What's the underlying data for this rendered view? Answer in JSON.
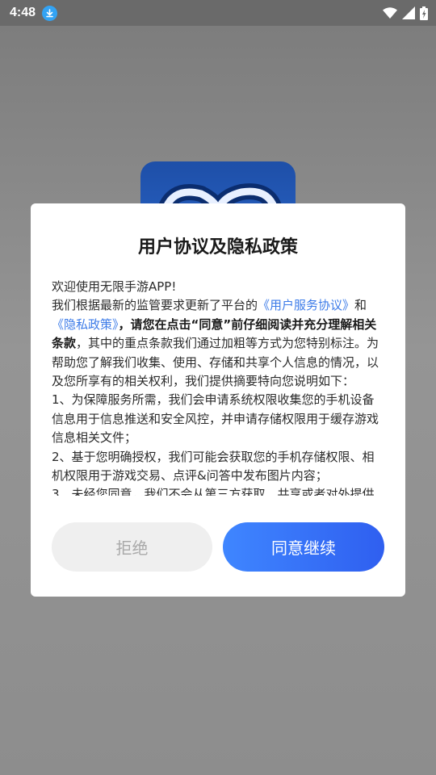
{
  "status_bar": {
    "time": "4:48",
    "icons": [
      "download-icon",
      "wifi-icon",
      "signal-icon",
      "battery-icon"
    ]
  },
  "dialog": {
    "title": "用户协议及隐私政策",
    "greeting": "欢迎使用无限手游APP!",
    "intro_text": "我们根据最新的监管要求更新了平台的",
    "link_service": "《用户服务协议》",
    "and": "和",
    "link_privacy": "《隐私政策》",
    "bold_text": "，请您在点击“同意”前仔细阅读并充分理解相关条款",
    "after_bold": "，其中的重点条款我们通过加粗等方式为您特别标注。为帮助您了解我们收集、使用、存储和共享个人信息的情况，以及您所享有的相关权利，我们提供摘要特向您说明如下：",
    "item1": "1、为保障服务所需，我们会申请系统权限收集您的手机设备信息用于信息推送和安全风控，并申请存储权限用于缓存游戏信息相关文件；",
    "item2": "2、基于您明确授权，我们可能会获取您的手机存储权限、相机权限用于游戏交易、点评&问答中发布图片内容；",
    "item3": "3、未经您同意，我们不会从第三方获取、共享或者对外提供",
    "reject_label": "拒绝",
    "accept_label": "同意继续"
  },
  "colors": {
    "link": "#3c7be8",
    "accept_gradient_start": "#3f86ff",
    "accept_gradient_end": "#2f5ff0",
    "reject_bg": "#efefef"
  }
}
